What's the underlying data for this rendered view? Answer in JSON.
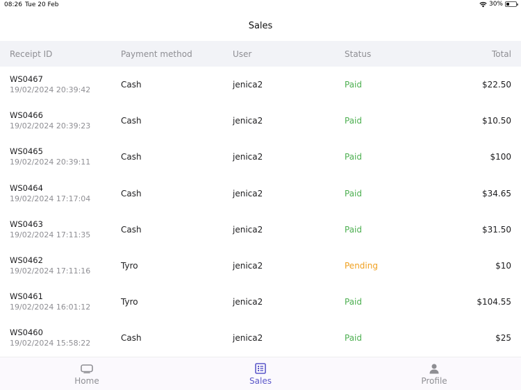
{
  "status_bar": {
    "time": "08:26",
    "date": "Tue 20 Feb",
    "battery": "30%",
    "battery_level": 0.3
  },
  "nav": {
    "title": "Sales"
  },
  "table": {
    "headers": {
      "receipt_id": "Receipt ID",
      "payment_method": "Payment method",
      "user": "User",
      "status": "Status",
      "total": "Total"
    },
    "rows": [
      {
        "id": "WS0467",
        "date": "19/02/2024 20:39:42",
        "payment": "Cash",
        "user": "jenica2",
        "status": "Paid",
        "total": "$22.50"
      },
      {
        "id": "WS0466",
        "date": "19/02/2024 20:39:23",
        "payment": "Cash",
        "user": "jenica2",
        "status": "Paid",
        "total": "$10.50"
      },
      {
        "id": "WS0465",
        "date": "19/02/2024 20:39:11",
        "payment": "Cash",
        "user": "jenica2",
        "status": "Paid",
        "total": "$100"
      },
      {
        "id": "WS0464",
        "date": "19/02/2024 17:17:04",
        "payment": "Cash",
        "user": "jenica2",
        "status": "Paid",
        "total": "$34.65"
      },
      {
        "id": "WS0463",
        "date": "19/02/2024 17:11:35",
        "payment": "Cash",
        "user": "jenica2",
        "status": "Paid",
        "total": "$31.50"
      },
      {
        "id": "WS0462",
        "date": "19/02/2024 17:11:16",
        "payment": "Tyro",
        "user": "jenica2",
        "status": "Pending",
        "total": "$10"
      },
      {
        "id": "WS0461",
        "date": "19/02/2024 16:01:12",
        "payment": "Tyro",
        "user": "jenica2",
        "status": "Paid",
        "total": "$104.55"
      },
      {
        "id": "WS0460",
        "date": "19/02/2024 15:58:22",
        "payment": "Cash",
        "user": "jenica2",
        "status": "Paid",
        "total": "$25"
      }
    ]
  },
  "tabbar": {
    "home": {
      "label": "Home",
      "icon": "tv-icon"
    },
    "sales": {
      "label": "Sales",
      "icon": "receipt-list-icon",
      "active": true
    },
    "profile": {
      "label": "Profile",
      "icon": "person-icon"
    }
  },
  "colors": {
    "accent": "#5b57c9",
    "paid": "#4caf50",
    "pending": "#f0a020",
    "header_bg": "#f2f3f7"
  }
}
